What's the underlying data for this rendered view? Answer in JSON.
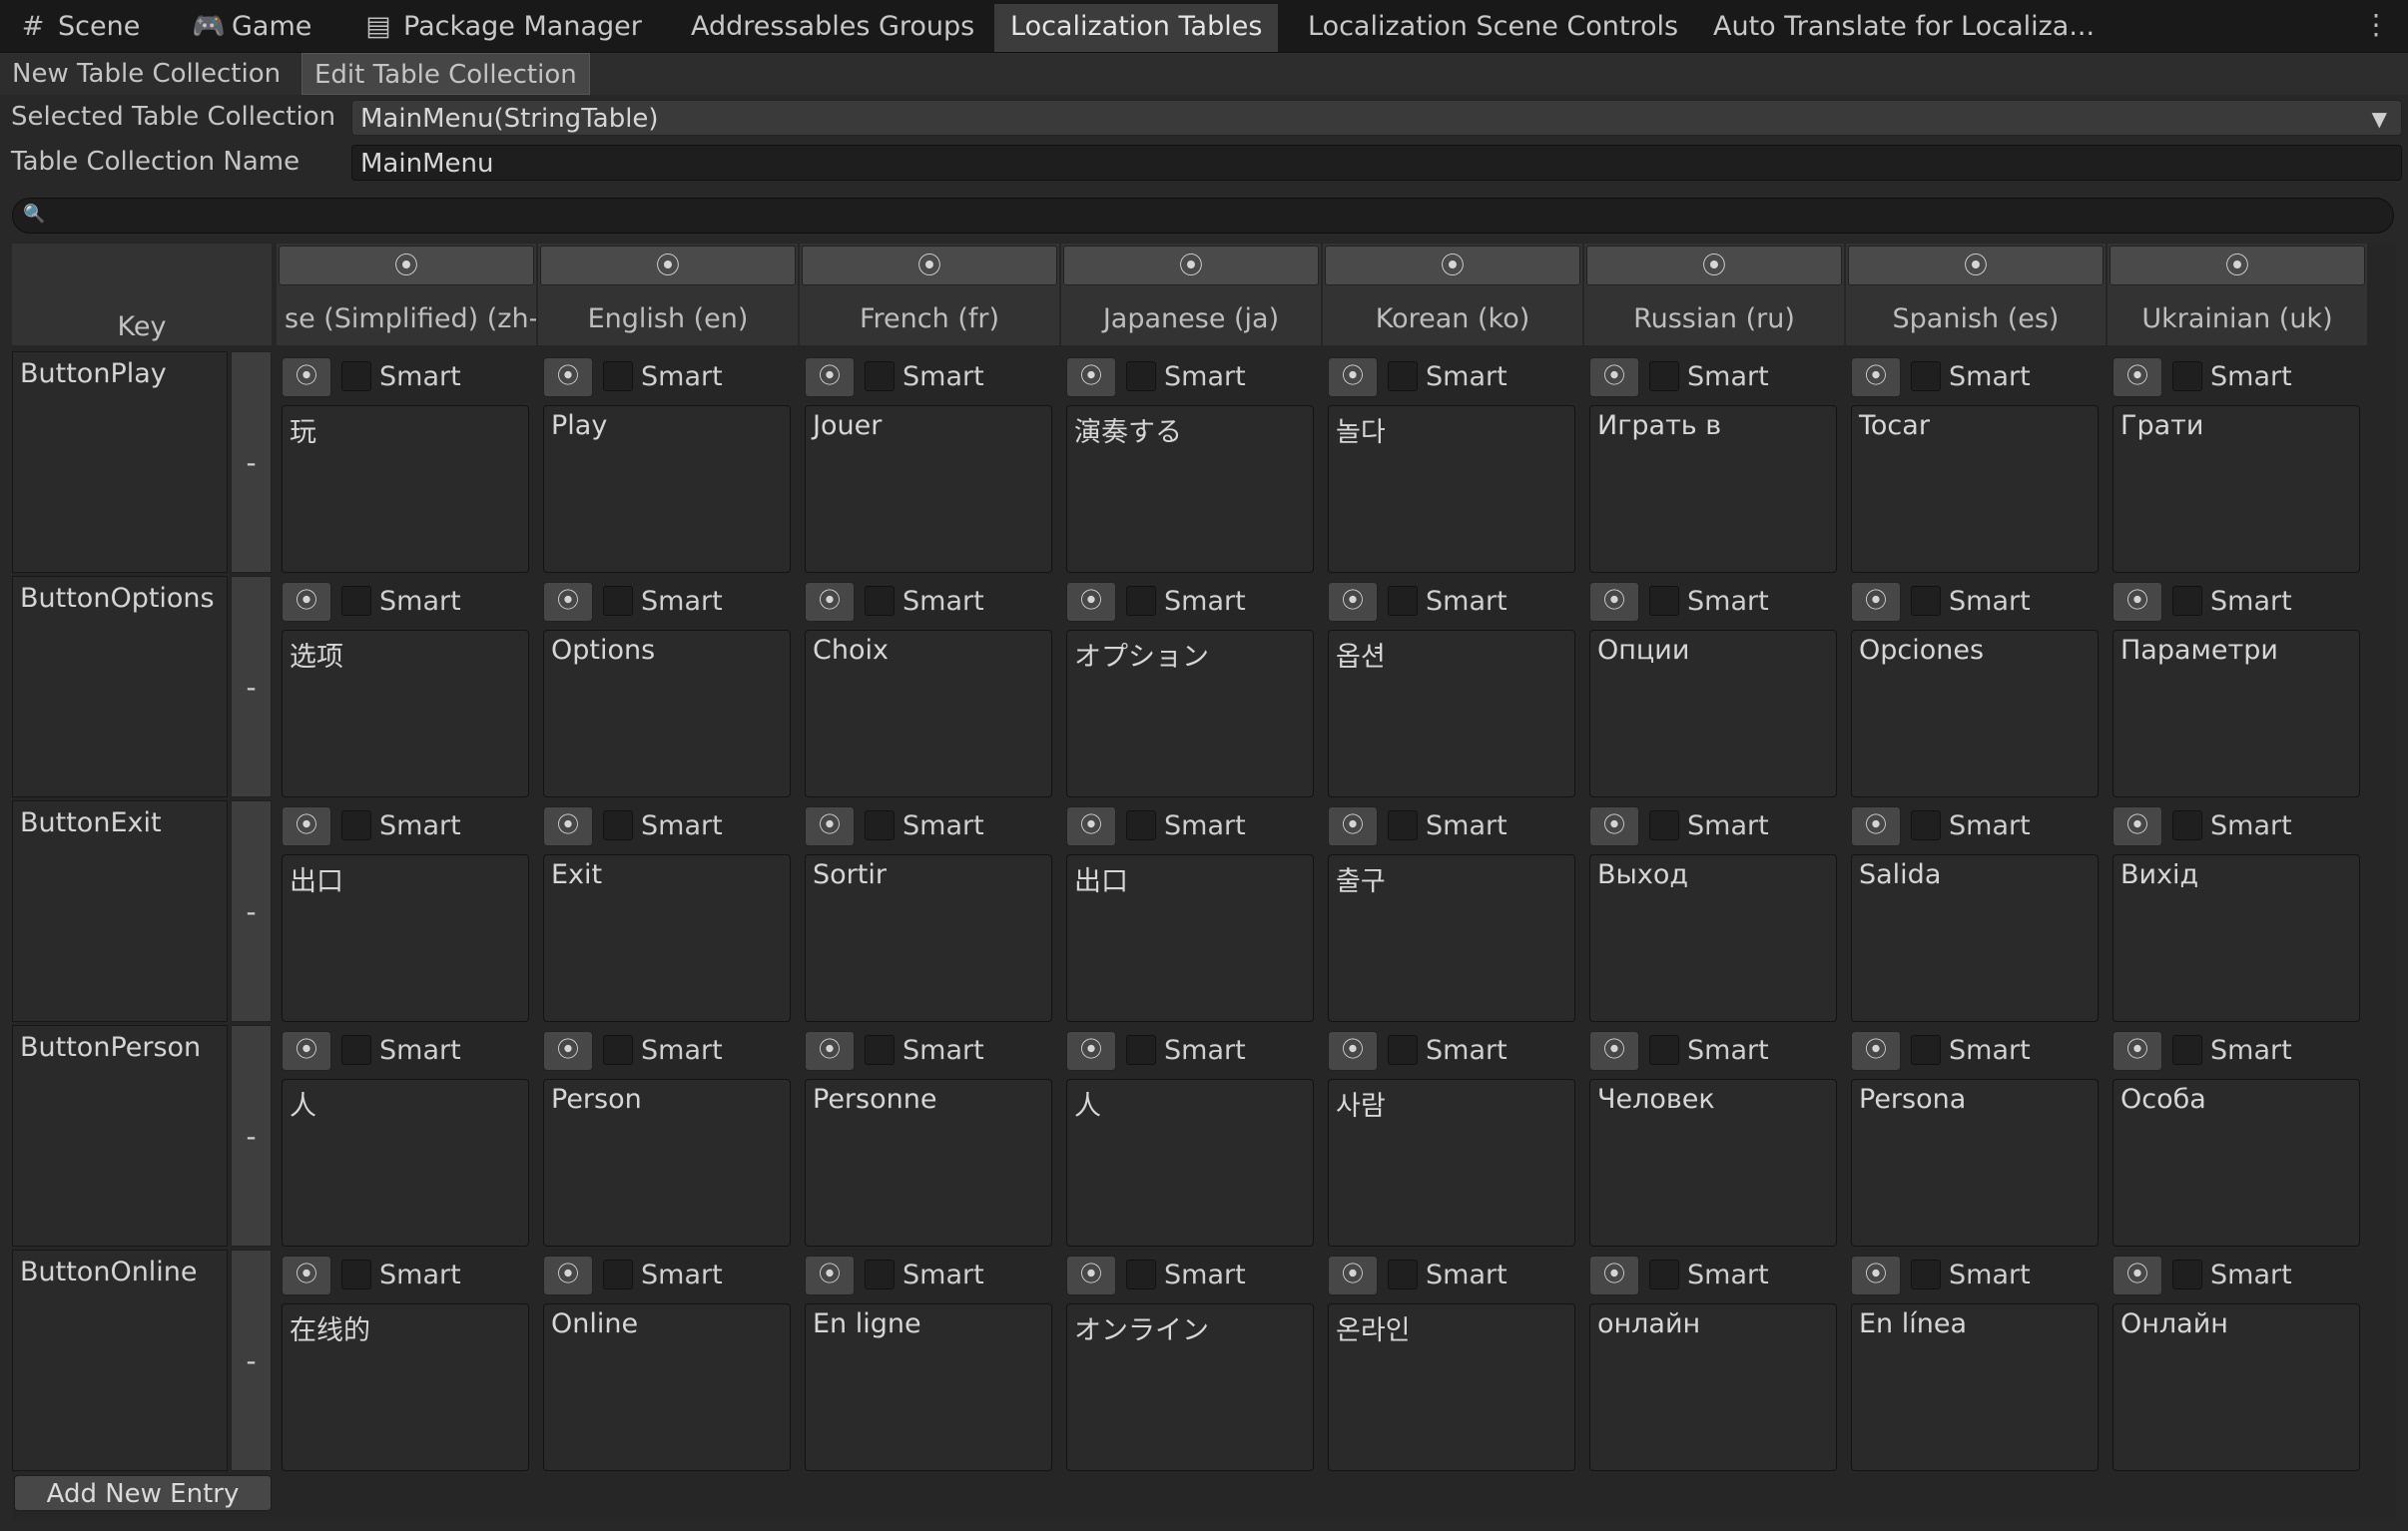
{
  "tabs": [
    {
      "label": "Scene",
      "icon": "grid-icon"
    },
    {
      "label": "Game",
      "icon": "gamepad-icon"
    },
    {
      "label": "Package Manager",
      "icon": "package-icon"
    },
    {
      "label": "Addressables Groups",
      "icon": ""
    },
    {
      "label": "Localization Tables",
      "icon": ""
    },
    {
      "label": "Localization Scene Controls",
      "icon": ""
    },
    {
      "label": "Auto Translate for Localiza...",
      "icon": ""
    }
  ],
  "subtoolbar": {
    "new_label": "New Table Collection",
    "edit_label": "Edit Table Collection"
  },
  "fields": {
    "selected_label": "Selected Table Collection",
    "selected_value": "MainMenu(StringTable)",
    "name_label": "Table Collection Name",
    "name_value": "MainMenu"
  },
  "table": {
    "key_header": "Key",
    "smart_label": "Smart",
    "delete_label": "-",
    "languages": [
      "se (Simplified) (zh-H",
      "English (en)",
      "French (fr)",
      "Japanese (ja)",
      "Korean (ko)",
      "Russian (ru)",
      "Spanish (es)",
      "Ukrainian (uk)"
    ],
    "rows": [
      {
        "key": "ButtonPlay",
        "values": [
          "玩",
          "Play",
          "Jouer",
          "演奏する",
          "놀다",
          "Играть в",
          "Tocar",
          "Грати"
        ]
      },
      {
        "key": "ButtonOptions",
        "values": [
          "选项",
          "Options",
          "Choix",
          "オプション",
          "옵션",
          "Опции",
          "Opciones",
          "Параметри"
        ]
      },
      {
        "key": "ButtonExit",
        "values": [
          "出口",
          "Exit",
          "Sortir",
          "出口",
          "출구",
          "Выход",
          "Salida",
          "Вихід"
        ]
      },
      {
        "key": "ButtonPerson",
        "values": [
          "人",
          "Person",
          "Personne",
          "人",
          "사람",
          "Человек",
          "Persona",
          "Особа"
        ]
      },
      {
        "key": "ButtonOnline",
        "values": [
          "在线的",
          "Online",
          "En ligne",
          "オンライン",
          "온라인",
          "онлайн",
          "En línea",
          "Онлайн"
        ]
      }
    ]
  },
  "add_entry_label": "Add New Entry"
}
